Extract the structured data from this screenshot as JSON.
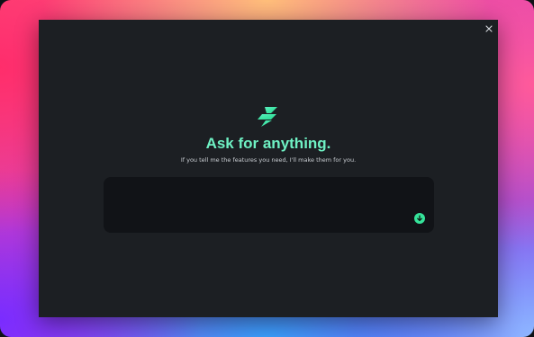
{
  "window": {
    "close_icon": "close-icon"
  },
  "hero": {
    "logo_icon": "lightning-bolt-icon",
    "title": "Ask for anything.",
    "subtitle": "If you tell me the features you need, I'll make them for you."
  },
  "prompt": {
    "value": "",
    "placeholder": "",
    "submit_icon": "arrow-down-circle-icon"
  },
  "colors": {
    "accent": "#35e39a",
    "title": "#6ff2c4",
    "window_bg": "#1c1f23",
    "input_bg": "#111317"
  }
}
